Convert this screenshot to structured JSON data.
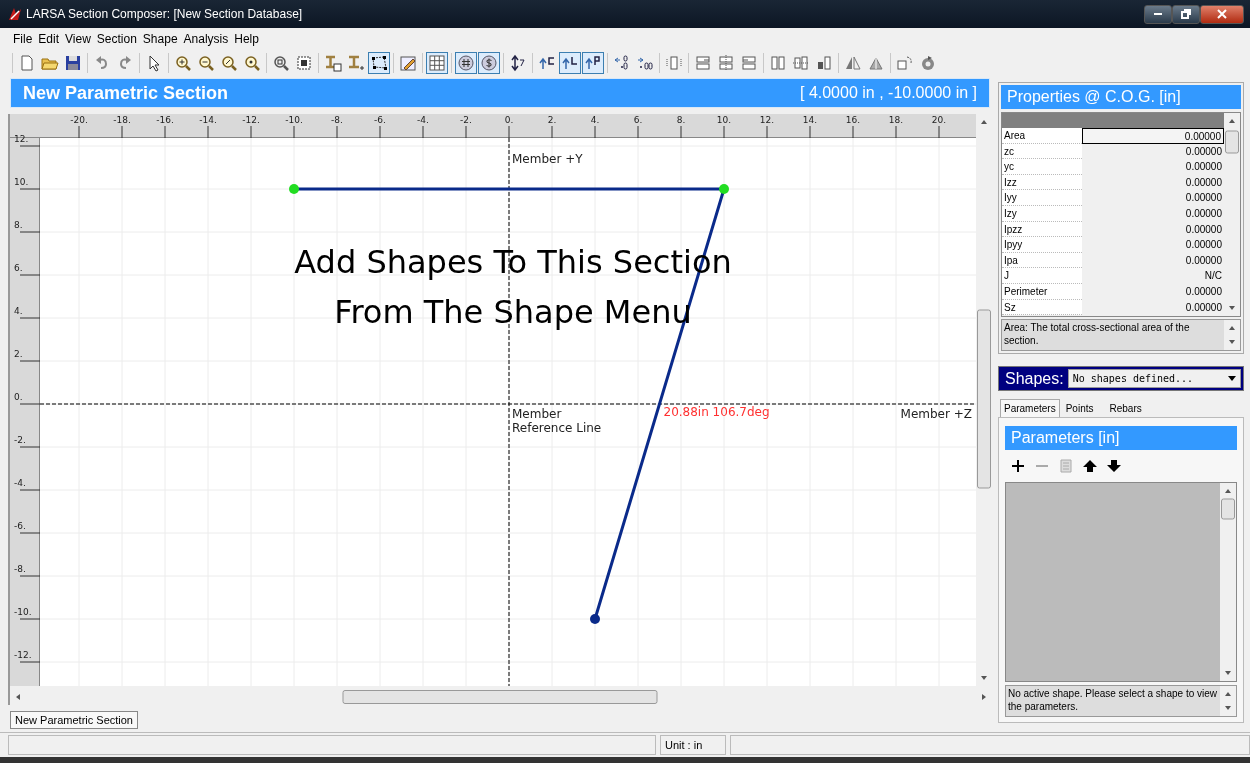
{
  "window": {
    "title": "LARSA Section Composer: [New Section Database]"
  },
  "menu": [
    {
      "label": "File"
    },
    {
      "label": "Edit"
    },
    {
      "label": "View"
    },
    {
      "label": "Section"
    },
    {
      "label": "Shape"
    },
    {
      "label": "Analysis"
    },
    {
      "label": "Help"
    }
  ],
  "toolbar": [
    [
      {
        "kind": "new",
        "pressed": false
      },
      {
        "kind": "open",
        "pressed": false
      },
      {
        "kind": "save",
        "pressed": false
      }
    ],
    [
      {
        "kind": "undo",
        "pressed": false
      },
      {
        "kind": "redo",
        "pressed": false
      }
    ],
    [
      {
        "kind": "pointer",
        "pressed": false
      }
    ],
    [
      {
        "kind": "zoom-in",
        "pressed": false
      },
      {
        "kind": "zoom-out",
        "pressed": false
      },
      {
        "kind": "zoom-extents",
        "pressed": false
      },
      {
        "kind": "zoom-previous",
        "pressed": false
      }
    ],
    [
      {
        "kind": "zoom-window",
        "pressed": false
      },
      {
        "kind": "fit",
        "pressed": false
      }
    ],
    [
      {
        "kind": "add-shape",
        "pressed": false
      },
      {
        "kind": "add-beam",
        "pressed": false
      },
      {
        "kind": "nodes",
        "pressed": true
      }
    ],
    [
      {
        "kind": "edit",
        "pressed": false
      }
    ],
    [
      {
        "kind": "grid",
        "pressed": true
      }
    ],
    [
      {
        "kind": "snap-grid",
        "pressed": true
      },
      {
        "kind": "snap-dollar",
        "pressed": true
      }
    ],
    [
      {
        "kind": "dimension",
        "pressed": false
      }
    ],
    [
      {
        "kind": "label-c",
        "pressed": false
      },
      {
        "kind": "label-l",
        "pressed": true
      },
      {
        "kind": "label-p",
        "pressed": true
      }
    ],
    [
      {
        "kind": "decimals-more",
        "pressed": false
      },
      {
        "kind": "decimals-less",
        "pressed": false
      }
    ],
    [
      {
        "kind": "distribute",
        "pressed": false
      }
    ],
    [
      {
        "kind": "align-left",
        "pressed": false
      },
      {
        "kind": "align-center",
        "pressed": false
      },
      {
        "kind": "align-right",
        "pressed": false
      }
    ],
    [
      {
        "kind": "align-top",
        "pressed": false
      },
      {
        "kind": "align-middle",
        "pressed": false
      },
      {
        "kind": "align-bottom",
        "pressed": false
      }
    ],
    [
      {
        "kind": "mirror-h",
        "pressed": false
      },
      {
        "kind": "mirror-v",
        "pressed": false
      }
    ],
    [
      {
        "kind": "rotate",
        "pressed": false
      },
      {
        "kind": "rotate-step",
        "pressed": false
      }
    ]
  ],
  "canvas": {
    "title": "New Parametric Section",
    "cursor": "[ 4.0000 in , -10.0000 in ]",
    "x_ticks": [
      "-20.",
      "-18.",
      "-16.",
      "-14.",
      "-12.",
      "-10.",
      "-8.",
      "-6.",
      "-4.",
      "-2.",
      "0.",
      "2.",
      "4.",
      "6.",
      "8.",
      "10.",
      "12.",
      "14.",
      "16.",
      "18.",
      "20."
    ],
    "y_ticks": [
      "12.",
      "10.",
      "8.",
      "6.",
      "4.",
      "2.",
      "0.",
      "-2.",
      "-4.",
      "-6.",
      "-8.",
      "-10.",
      "-12."
    ],
    "y_axis_label": "Member +Y",
    "z_axis_label": "Member +Z",
    "reference_label": "Member Reference Line",
    "message": [
      "Add Shapes To This Section",
      "From The Shape Menu"
    ],
    "measure": "20.88in  106.7deg"
  },
  "properties": {
    "title": "Properties @ C.O.G. [in]",
    "rows": [
      {
        "name": "Area",
        "value": "0.00000",
        "selected": true
      },
      {
        "name": "zc",
        "value": "0.00000",
        "selected": false
      },
      {
        "name": "yc",
        "value": "0.00000",
        "selected": false
      },
      {
        "name": "Izz",
        "value": "0.00000",
        "selected": false
      },
      {
        "name": "Iyy",
        "value": "0.00000",
        "selected": false
      },
      {
        "name": "Izy",
        "value": "0.00000",
        "selected": false
      },
      {
        "name": "Ipzz",
        "value": "0.00000",
        "selected": false
      },
      {
        "name": "Ipyy",
        "value": "0.00000",
        "selected": false
      },
      {
        "name": "Ipa",
        "value": "0.00000",
        "selected": false
      },
      {
        "name": "J",
        "value": "N/C",
        "selected": false
      },
      {
        "name": "Perimeter",
        "value": "0.00000",
        "selected": false
      },
      {
        "name": "Sz",
        "value": "0.00000",
        "selected": false
      }
    ],
    "description": "Area: The total cross-sectional area of the section."
  },
  "shapes": {
    "label": "Shapes:",
    "dropdown": "No shapes defined..."
  },
  "tabs": [
    {
      "label": "Parameters",
      "selected": true
    },
    {
      "label": "Points",
      "selected": false
    },
    {
      "label": "Rebars",
      "selected": false
    }
  ],
  "parameters": {
    "title": "Parameters [in]",
    "tools": [
      {
        "kind": "add",
        "disabled": false
      },
      {
        "kind": "remove",
        "disabled": true
      },
      {
        "kind": "properties",
        "disabled": true
      },
      {
        "kind": "up",
        "disabled": false
      },
      {
        "kind": "down",
        "disabled": false
      }
    ],
    "description": "No active shape. Please select a shape to view the parameters."
  },
  "document_tabs": [
    {
      "label": "New Parametric Section",
      "selected": true
    }
  ],
  "status_bar": {
    "unit": "Unit : in"
  }
}
